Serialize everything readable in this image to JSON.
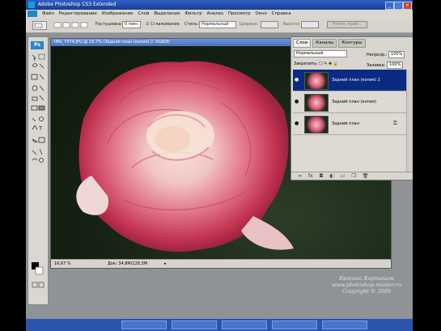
{
  "app": {
    "title": "Adobe Photoshop CS3 Extended"
  },
  "menu": [
    "Файл",
    "Редактирование",
    "Изображение",
    "Слой",
    "Выделение",
    "Фильтр",
    "Анализ",
    "Просмотр",
    "Окно",
    "Справка"
  ],
  "options": {
    "feather_label": "Растушевка:",
    "feather_value": "0 пикс",
    "antialias_label": "Сглаживание",
    "style_label": "Стиль:",
    "style_value": "Нормальный",
    "width_label": "Ширина:",
    "height_label": "Высота:",
    "refine_label": "Уточн. край..."
  },
  "document": {
    "title": "IMG_7074.JPG @ 16,7% (Задний план (копия) 2, RGB/8)",
    "zoom": "16,67 %",
    "doc_info": "Док: 34,8M/128,3M"
  },
  "layers_panel": {
    "tabs": [
      "Слои",
      "Каналы",
      "Контуры"
    ],
    "blend_mode": "Нормальный",
    "opacity_label": "Непрозр.:",
    "opacity_value": "100%",
    "lock_label": "Закрепить:",
    "fill_label": "Заливка:",
    "fill_value": "100%",
    "layers": [
      {
        "name": "Задний план (копия) 2",
        "selected": true
      },
      {
        "name": "Задний план (копия)",
        "selected": false
      },
      {
        "name": "Задний план",
        "selected": false
      }
    ]
  },
  "watermark": {
    "line1": "Евгений Карташов",
    "line2": "www.photoshop-master.ru",
    "line3": "Copyright © 2009"
  },
  "taskbar_count": 5
}
